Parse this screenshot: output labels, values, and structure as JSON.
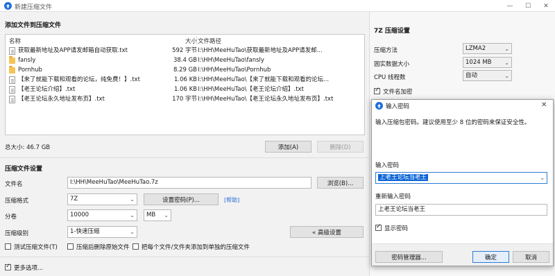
{
  "window": {
    "title": "新建压缩文件"
  },
  "files": {
    "section_title": "添加文件到压缩文件",
    "columns": {
      "name": "名称",
      "size": "大小",
      "path": "文件路径"
    },
    "rows": [
      {
        "icon": "file-icon",
        "name": "获取最新地址及APP请发邮箱自动获取.txt",
        "size": "592 字节",
        "path": "I:\\HH\\MeeHuTao\\获取最新地址及APP请发邮..."
      },
      {
        "icon": "folder-icon",
        "name": "fansly",
        "size": "38.4 GB",
        "path": "I:\\HH\\MeeHuTao\\fansly"
      },
      {
        "icon": "folder-icon",
        "name": "Pornhub",
        "size": "8.29 GB",
        "path": "I:\\HH\\MeeHuTao\\Pornhub"
      },
      {
        "icon": "file-icon",
        "name": "【来了就能下载和观看的论坛，纯免费！】.txt",
        "size": "1.06 KB",
        "path": "I:\\HH\\MeeHuTao\\【来了就能下载和观看的论坛..."
      },
      {
        "icon": "file-icon",
        "name": "【老王论坛介绍】.txt",
        "size": "1.06 KB",
        "path": "I:\\HH\\MeeHuTao\\【老王论坛介绍】.txt"
      },
      {
        "icon": "file-icon",
        "name": "【老王论坛永久地址发布页】.txt",
        "size": "170 字节",
        "path": "I:\\HH\\MeeHuTao\\【老王论坛永久地址发布页】.txt"
      }
    ],
    "total_size": "总大小: 46.7 GB",
    "add_label": "添加(A)",
    "delete_label": "删除(D)"
  },
  "settings": {
    "section_title": "压缩文件设置",
    "filename_label": "文件名",
    "filename_value": "I:\\HH\\MeeHuTao\\MeeHuTao.7z",
    "browse_label": "浏览(B)...",
    "format_label": "压缩格式",
    "format_value": "7Z",
    "set_password_label": "设置密码(P)...",
    "help_link": "[帮助]",
    "split_label": "分卷",
    "split_value": "10000",
    "split_unit": "MB",
    "level_label": "压缩级别",
    "level_value": "1-快速压缩",
    "advanced_label": "« 高级设置",
    "option_test": "测试压缩文件(T)",
    "option_delete": "压缩后删除原始文件",
    "option_separate": "把每个文件/文件夹添加到单独的压缩文件",
    "more_options": "更多选项..."
  },
  "sevenz": {
    "section_title": "7Z 压缩设置",
    "method_label": "压缩方法",
    "method_value": "LZMA2",
    "solid_label": "固实数据大小",
    "solid_value": "1024 MB",
    "cpu_label": "CPU 线程数",
    "cpu_value": "自动",
    "encrypt_names": "文件名加密"
  },
  "dialog": {
    "title": "输入密码",
    "description": "输入压缩包密码。建议使用至少 8 位的密码来保证安全性。",
    "password_label": "输入密码",
    "password_value": "上老王论坛当老王",
    "repeat_label": "重新输入密码",
    "repeat_value": "上老王论坛当老王",
    "show_password": "显示密码",
    "manager_label": "密码管理器...",
    "ok_label": "确定",
    "cancel_label": "取消"
  }
}
